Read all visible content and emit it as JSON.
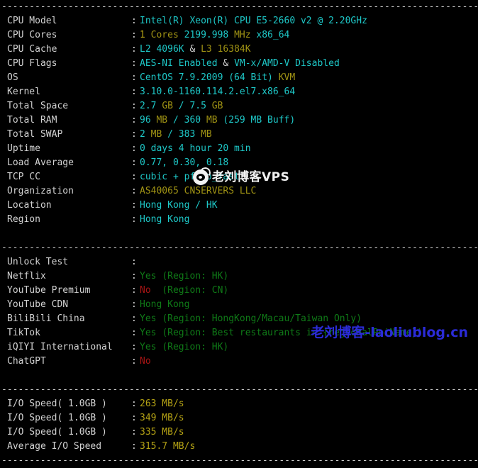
{
  "terminal": {
    "separator": "-------------------------------------------------------------------------------------------------",
    "colon": ":",
    "sections": {
      "system": [
        {
          "label": "CPU Model",
          "parts": [
            {
              "t": "Intel(R) Xeon(R) CPU E5-2660 v2 @ 2.20GHz",
              "c": "c-cyan"
            }
          ]
        },
        {
          "label": "CPU Cores",
          "parts": [
            {
              "t": "1 ",
              "c": "c-yellow"
            },
            {
              "t": "Cores ",
              "c": "c-olive"
            },
            {
              "t": "2199.998 ",
              "c": "c-cyan"
            },
            {
              "t": "MHz ",
              "c": "c-olive"
            },
            {
              "t": "x86_64",
              "c": "c-cyan"
            }
          ]
        },
        {
          "label": "CPU Cache",
          "parts": [
            {
              "t": "L2 4096K ",
              "c": "c-cyan"
            },
            {
              "t": "& ",
              "c": "c-grey"
            },
            {
              "t": "L3 16384K",
              "c": "c-olive"
            }
          ]
        },
        {
          "label": "CPU Flags",
          "parts": [
            {
              "t": "AES-NI Enabled ",
              "c": "c-cyan"
            },
            {
              "t": "& ",
              "c": "c-grey"
            },
            {
              "t": "VM-x/AMD-V Disabled",
              "c": "c-cyan"
            }
          ]
        },
        {
          "label": "OS",
          "parts": [
            {
              "t": "CentOS 7.9.2009 ",
              "c": "c-cyan"
            },
            {
              "t": "(64 Bit) ",
              "c": "c-cyan"
            },
            {
              "t": "KVM",
              "c": "c-olive"
            }
          ]
        },
        {
          "label": "Kernel",
          "parts": [
            {
              "t": "3.10.0-1160.114.2.el7.x86_64",
              "c": "c-cyan"
            }
          ]
        },
        {
          "label": "Total Space",
          "parts": [
            {
              "t": "2.7 ",
              "c": "c-cyan"
            },
            {
              "t": "GB ",
              "c": "c-olive"
            },
            {
              "t": "/ ",
              "c": "c-cyan"
            },
            {
              "t": "7.5 ",
              "c": "c-cyan"
            },
            {
              "t": "GB",
              "c": "c-olive"
            }
          ]
        },
        {
          "label": "Total RAM",
          "parts": [
            {
              "t": "96 ",
              "c": "c-cyan"
            },
            {
              "t": "MB ",
              "c": "c-olive"
            },
            {
              "t": "/ ",
              "c": "c-cyan"
            },
            {
              "t": "360 ",
              "c": "c-cyan"
            },
            {
              "t": "MB ",
              "c": "c-olive"
            },
            {
              "t": "(259 MB Buff)",
              "c": "c-cyan"
            }
          ]
        },
        {
          "label": "Total SWAP",
          "parts": [
            {
              "t": "2 ",
              "c": "c-cyan"
            },
            {
              "t": "MB ",
              "c": "c-olive"
            },
            {
              "t": "/ ",
              "c": "c-cyan"
            },
            {
              "t": "383 ",
              "c": "c-cyan"
            },
            {
              "t": "MB",
              "c": "c-olive"
            }
          ]
        },
        {
          "label": "Uptime",
          "parts": [
            {
              "t": "0 days 4 hour 20 min",
              "c": "c-cyan"
            }
          ]
        },
        {
          "label": "Load Average",
          "parts": [
            {
              "t": "0.77, 0.30, 0.18",
              "c": "c-cyan"
            }
          ]
        },
        {
          "label": "TCP CC",
          "parts": [
            {
              "t": "cubic + pfifo_fast",
              "c": "c-cyan"
            }
          ]
        },
        {
          "label": "Organization",
          "parts": [
            {
              "t": "AS40065 CNSERVERS LLC",
              "c": "c-olive"
            }
          ]
        },
        {
          "label": "Location",
          "parts": [
            {
              "t": "Hong Kong / HK",
              "c": "c-cyan"
            }
          ]
        },
        {
          "label": "Region",
          "parts": [
            {
              "t": "Hong Kong",
              "c": "c-cyan"
            }
          ]
        }
      ],
      "unlock": [
        {
          "label": "Unlock Test",
          "parts": []
        },
        {
          "label": "Netflix",
          "parts": [
            {
              "t": "Yes ",
              "c": "c-green"
            },
            {
              "t": "(Region: HK)",
              "c": "c-green"
            }
          ]
        },
        {
          "label": "YouTube Premium",
          "parts": [
            {
              "t": "No ",
              "c": "c-red"
            },
            {
              "t": " (Region: CN)",
              "c": "c-green"
            }
          ]
        },
        {
          "label": "YouTube CDN",
          "parts": [
            {
              "t": "Hong Kong",
              "c": "c-green"
            }
          ]
        },
        {
          "label": "BiliBili China",
          "parts": [
            {
              "t": "Yes ",
              "c": "c-green"
            },
            {
              "t": "(Region: HongKong/Macau/Taiwan Only)",
              "c": "c-green"
            }
          ]
        },
        {
          "label": "TikTok",
          "parts": [
            {
              "t": "Yes ",
              "c": "c-green"
            },
            {
              "t": "(Region: Best restaurants in {regionalPoiName})",
              "c": "c-green"
            }
          ]
        },
        {
          "label": "iQIYI International",
          "parts": [
            {
              "t": "Yes ",
              "c": "c-green"
            },
            {
              "t": "(Region: HK)",
              "c": "c-green"
            }
          ]
        },
        {
          "label": "ChatGPT",
          "parts": [
            {
              "t": "No",
              "c": "c-red"
            }
          ]
        }
      ],
      "io": [
        {
          "label": "I/O Speed( 1.0GB )",
          "parts": [
            {
              "t": "263 MB/s",
              "c": "c-yellow"
            }
          ]
        },
        {
          "label": "I/O Speed( 1.0GB )",
          "parts": [
            {
              "t": "349 MB/s",
              "c": "c-yellow"
            }
          ]
        },
        {
          "label": "I/O Speed( 1.0GB )",
          "parts": [
            {
              "t": "335 MB/s",
              "c": "c-yellow"
            }
          ]
        },
        {
          "label": "Average I/O Speed",
          "parts": [
            {
              "t": "315.7 MB/s",
              "c": "c-yellow"
            }
          ]
        }
      ]
    }
  },
  "watermarks": {
    "weibo": {
      "icon": "weibo-icon",
      "text": "老刘博客VPS",
      "color": "#f2f2f2"
    },
    "blog": {
      "text": "老刘博客-laoliublog.cn",
      "color": "#2b2bd8"
    }
  }
}
